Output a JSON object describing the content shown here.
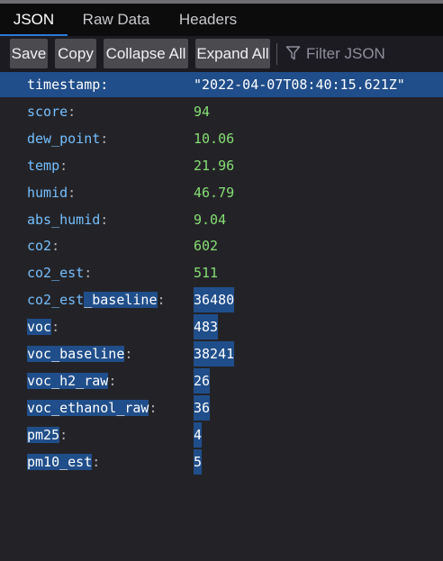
{
  "tabs": [
    {
      "label": "JSON",
      "active": true
    },
    {
      "label": "Raw Data",
      "active": false
    },
    {
      "label": "Headers",
      "active": false
    }
  ],
  "toolbar": {
    "save_label": "Save",
    "copy_label": "Copy",
    "collapse_label": "Collapse All",
    "expand_label": "Expand All",
    "filter_placeholder": "Filter JSON",
    "filter_icon": "filter-icon"
  },
  "colors": {
    "key": "#75bfff",
    "number": "#86de74",
    "selection": "#204e8a",
    "background": "#232327"
  },
  "rows": [
    {
      "key": "timestamp",
      "value": "\"2022-04-07T08:40:15.621Z\"",
      "type": "string"
    },
    {
      "key": "score",
      "value": "94",
      "type": "number"
    },
    {
      "key": "dew_point",
      "value": "10.06",
      "type": "number"
    },
    {
      "key": "temp",
      "value": "21.96",
      "type": "number"
    },
    {
      "key": "humid",
      "value": "46.79",
      "type": "number"
    },
    {
      "key": "abs_humid",
      "value": "9.04",
      "type": "number"
    },
    {
      "key": "co2",
      "value": "602",
      "type": "number"
    },
    {
      "key": "co2_est",
      "value": "511",
      "type": "number"
    },
    {
      "key": "co2_est_baseline",
      "value": "36480",
      "type": "number"
    },
    {
      "key": "voc",
      "value": "483",
      "type": "number"
    },
    {
      "key": "voc_baseline",
      "value": "38241",
      "type": "number"
    },
    {
      "key": "voc_h2_raw",
      "value": "26",
      "type": "number"
    },
    {
      "key": "voc_ethanol_raw",
      "value": "36",
      "type": "number"
    },
    {
      "key": "pm25",
      "value": "4",
      "type": "number"
    },
    {
      "key": "pm10_est",
      "value": "5",
      "type": "number"
    }
  ]
}
